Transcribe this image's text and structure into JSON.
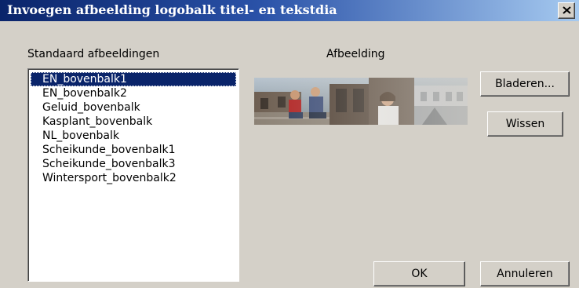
{
  "window": {
    "title": "Invoegen afbeelding logobalk titel- en tekstdia",
    "close_icon": "close-x-icon"
  },
  "standard_images": {
    "label": "Standaard afbeeldingen",
    "selected_index": 0,
    "items": [
      "EN_bovenbalk1",
      "EN_bovenbalk2",
      "Geluid_bovenbalk",
      "Kasplant_bovenbalk",
      "NL_bovenbalk",
      "Scheikunde_bovenbalk1",
      "Scheikunde_bovenbalk3",
      "Wintersport_bovenbalk2"
    ]
  },
  "image_panel": {
    "label": "Afbeelding"
  },
  "buttons": {
    "browse": "Bladeren...",
    "clear": "Wissen",
    "ok": "OK",
    "cancel": "Annuleren"
  },
  "colors": {
    "dialog_bg": "#d4d0c8",
    "titlebar_start": "#0a246a",
    "titlebar_end": "#a6caf0",
    "selection": "#0a246a"
  }
}
